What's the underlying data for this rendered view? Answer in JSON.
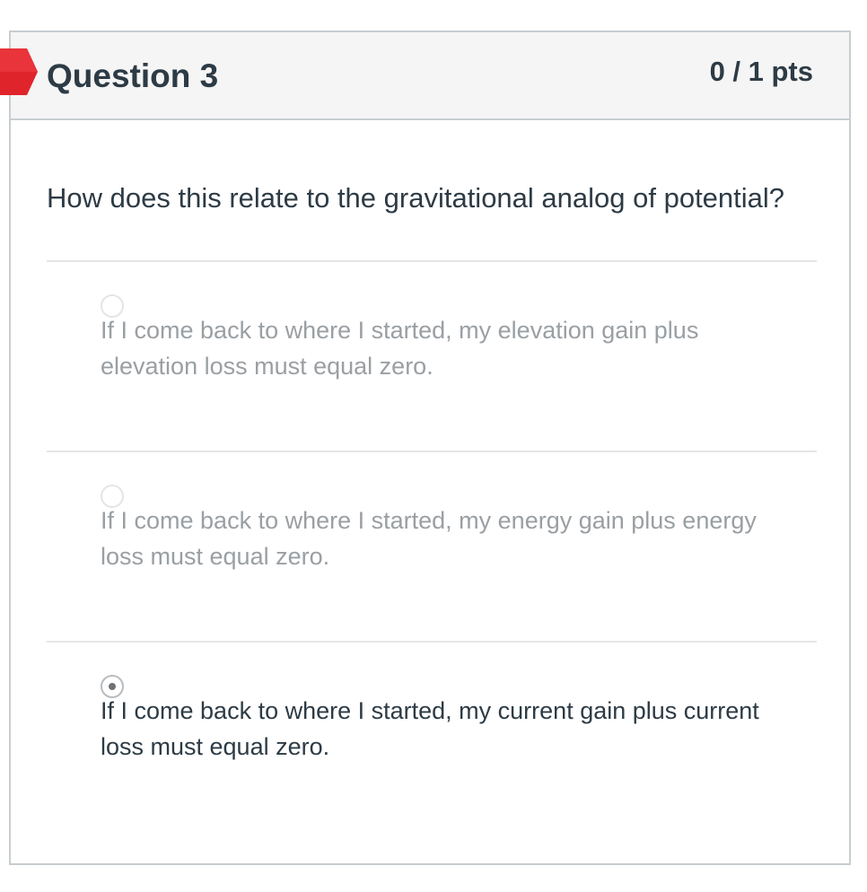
{
  "question": {
    "title": "Question 3",
    "points": "0 / 1 pts",
    "status_icon": "incorrect-flag-icon",
    "status_color": "#e0242b",
    "text": "How does this relate to the gravitational analog of potential?"
  },
  "answers": [
    {
      "label": "If I come back to where I started, my elevation gain plus elevation loss must equal zero.",
      "selected": false
    },
    {
      "label": "If I come back to where I started, my energy gain plus energy loss must equal zero.",
      "selected": false
    },
    {
      "label": "If I come back to where I started, my current gain plus current loss must equal zero.",
      "selected": true
    }
  ]
}
